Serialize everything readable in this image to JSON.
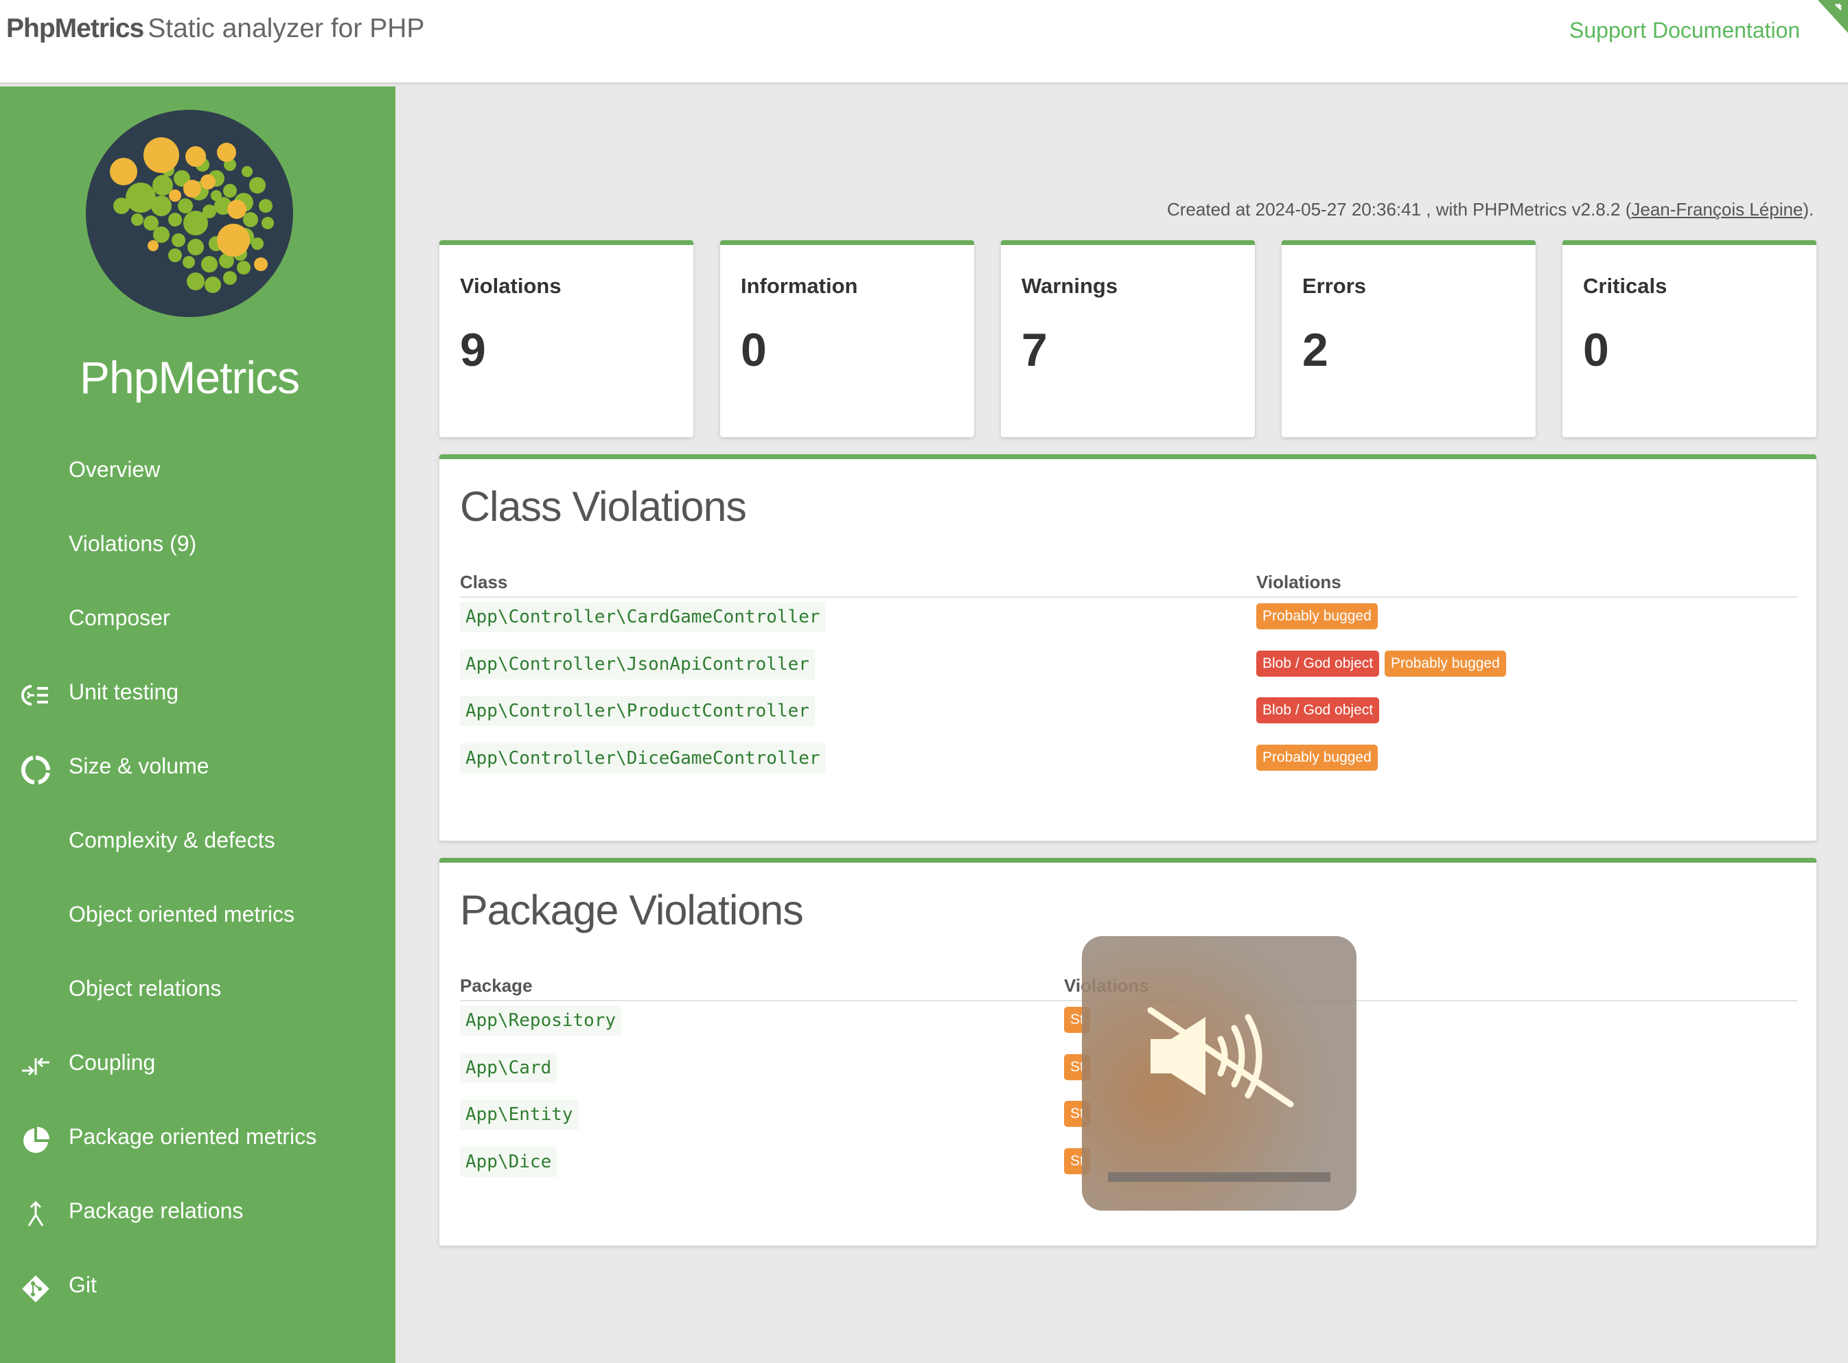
{
  "header": {
    "brand_name": "PhpMetrics",
    "brand_subtitle": "Static analyzer for PHP",
    "support_link": "Support Documentation"
  },
  "sidebar": {
    "title": "PhpMetrics",
    "items": [
      {
        "label": "Overview",
        "icon": ""
      },
      {
        "label": "Violations (9)",
        "icon": ""
      },
      {
        "label": "Composer",
        "icon": ""
      },
      {
        "label": "Unit testing",
        "icon": "unit-testing-icon"
      },
      {
        "label": "Size & volume",
        "icon": "size-volume-icon"
      },
      {
        "label": "Complexity & defects",
        "icon": ""
      },
      {
        "label": "Object oriented metrics",
        "icon": ""
      },
      {
        "label": "Object relations",
        "icon": ""
      },
      {
        "label": "Coupling",
        "icon": "coupling-icon"
      },
      {
        "label": "Package oriented metrics",
        "icon": "pie-chart-icon"
      },
      {
        "label": "Package relations",
        "icon": "merge-icon"
      },
      {
        "label": "Git",
        "icon": "git-icon"
      }
    ]
  },
  "created": {
    "prefix": "Created at 2024-05-27 20:36:41 , with PHPMetrics v2.8.2 (",
    "author": "Jean-François Lépine",
    "suffix": ")."
  },
  "summary_cards": [
    {
      "label": "Violations",
      "value": "9"
    },
    {
      "label": "Information",
      "value": "0"
    },
    {
      "label": "Warnings",
      "value": "7"
    },
    {
      "label": "Errors",
      "value": "2"
    },
    {
      "label": "Criticals",
      "value": "0"
    }
  ],
  "class_violations": {
    "title": "Class Violations",
    "col_class": "Class",
    "col_violations": "Violations",
    "rows": [
      {
        "class": "App\\Controller\\CardGameController",
        "badges": [
          "Probably bugged"
        ]
      },
      {
        "class": "App\\Controller\\JsonApiController",
        "badges": [
          "Blob / God object",
          "Probably bugged"
        ]
      },
      {
        "class": "App\\Controller\\ProductController",
        "badges": [
          "Blob / God object"
        ]
      },
      {
        "class": "App\\Controller\\DiceGameController",
        "badges": [
          "Probably bugged"
        ]
      }
    ]
  },
  "package_violations": {
    "title": "Package Violations",
    "col_package": "Package",
    "col_violations": "Violations",
    "rows": [
      {
        "package": "App\\Repository",
        "badge": "St"
      },
      {
        "package": "App\\Card",
        "badge": "St"
      },
      {
        "package": "App\\Entity",
        "badge": "St"
      },
      {
        "package": "App\\Dice",
        "badge": "St"
      }
    ]
  },
  "colors": {
    "accent": "#69ad5a",
    "link": "#5cb85c",
    "badge_warning": "#f0913a",
    "badge_error": "#e15041"
  },
  "overlay": {
    "icon": "speaker-muted-icon",
    "volume": 0
  }
}
